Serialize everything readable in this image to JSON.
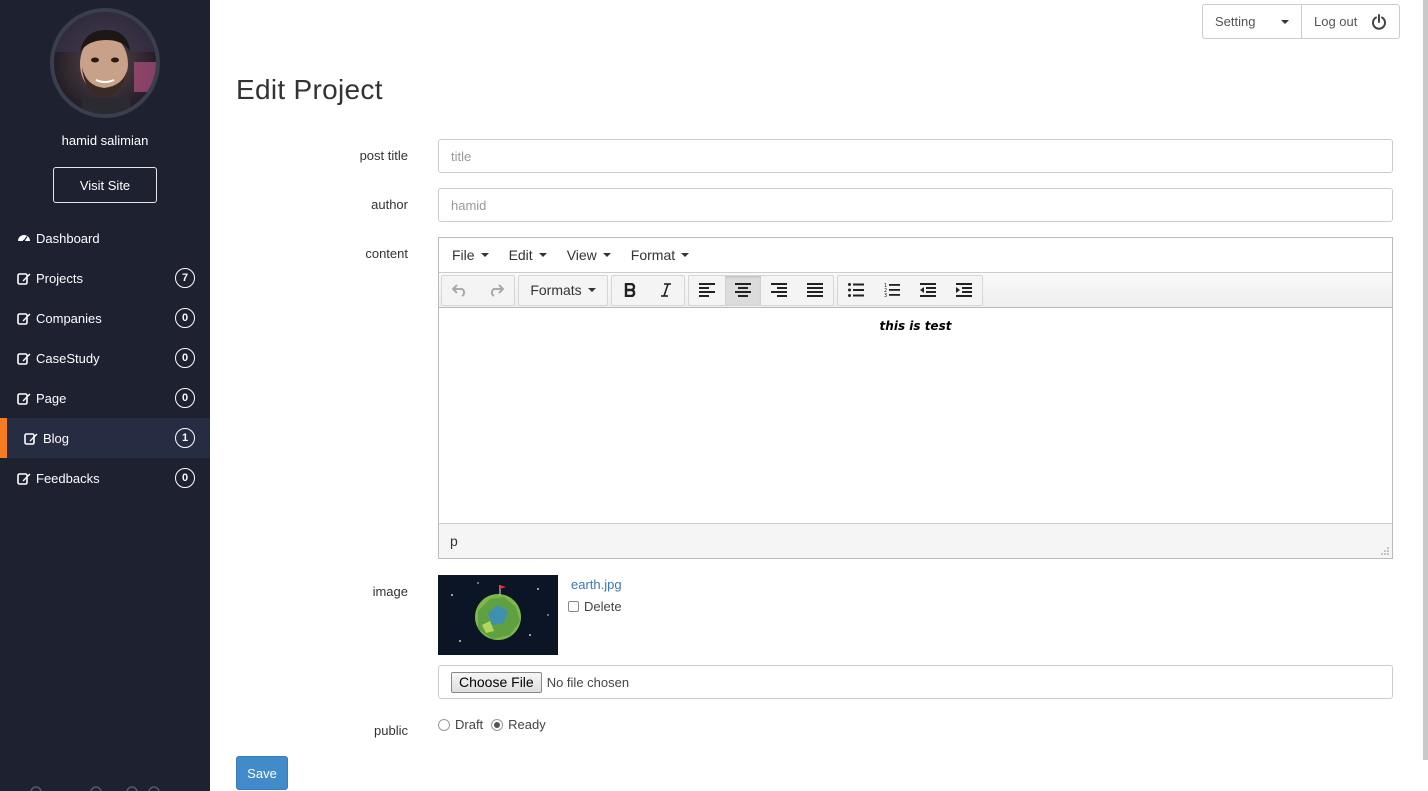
{
  "sidebar": {
    "username": "hamid salimian",
    "visit_site_label": "Visit Site",
    "items": [
      {
        "label": "Dashboard",
        "icon": "dashboard-icon",
        "count": null
      },
      {
        "label": "Projects",
        "icon": "edit-icon",
        "count": "7"
      },
      {
        "label": "Companies",
        "icon": "edit-icon",
        "count": "0"
      },
      {
        "label": "CaseStudy",
        "icon": "edit-icon",
        "count": "0"
      },
      {
        "label": "Page",
        "icon": "edit-icon",
        "count": "0"
      },
      {
        "label": "Blog",
        "icon": "edit-icon",
        "count": "1",
        "active": true
      },
      {
        "label": "Feedbacks",
        "icon": "edit-icon",
        "count": "0"
      }
    ],
    "accent_color": "#f47b20",
    "background_color": "#1d2130"
  },
  "topbar": {
    "setting_label": "Setting",
    "logout_label": "Log out",
    "logout_icon": "power-icon"
  },
  "page": {
    "title": "Edit Project"
  },
  "form": {
    "post_title": {
      "label": "post title",
      "placeholder": "title",
      "value": ""
    },
    "author": {
      "label": "author",
      "placeholder": "hamid",
      "value": ""
    },
    "content": {
      "label": "content",
      "menu": [
        "File",
        "Edit",
        "View",
        "Format"
      ],
      "formats_label": "Formats",
      "text": "this is test",
      "status_path": "p",
      "alignment": "center"
    },
    "image": {
      "label": "image",
      "file_name": "earth.jpg",
      "delete_label": "Delete",
      "choose_file_label": "Choose File",
      "no_file_text": "No file chosen"
    },
    "public": {
      "label": "public",
      "options": [
        "Draft",
        "Ready"
      ],
      "selected": "Ready"
    },
    "save_label": "Save"
  }
}
